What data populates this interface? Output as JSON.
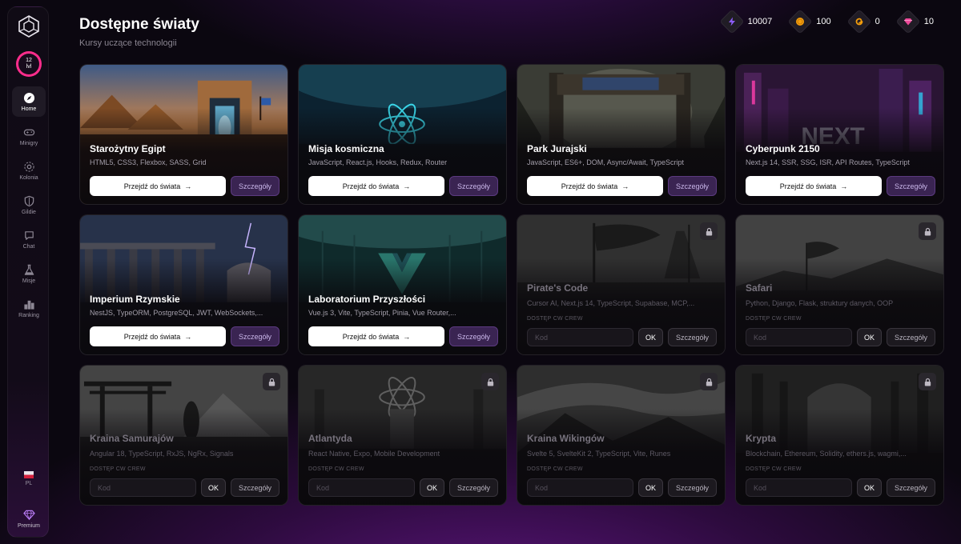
{
  "sidebar": {
    "level": {
      "value": "12",
      "unit": "lvl"
    },
    "nav": [
      {
        "label": "Home",
        "icon": "compass-icon",
        "active": true
      },
      {
        "label": "Minigry",
        "icon": "gamepad-icon"
      },
      {
        "label": "Kolonia",
        "icon": "colony-icon"
      },
      {
        "label": "Gildie",
        "icon": "shield-icon"
      },
      {
        "label": "Chat",
        "icon": "chat-icon"
      },
      {
        "label": "Misje",
        "icon": "flask-icon"
      },
      {
        "label": "Ranking",
        "icon": "ranking-icon"
      }
    ],
    "language": {
      "label": "PL",
      "icon": "flag-pl-icon"
    },
    "premium": {
      "label": "Premium",
      "icon": "diamond-icon"
    }
  },
  "header": {
    "title": "Dostępne światy",
    "subtitle": "Kursy uczące technologii"
  },
  "stats": [
    {
      "icon": "energy-icon",
      "value": "10007",
      "color": "#8b5cf6"
    },
    {
      "icon": "coin-icon",
      "value": "100",
      "color": "#f59e0b"
    },
    {
      "icon": "spiral-icon",
      "value": "0",
      "color": "#f59e0b"
    },
    {
      "icon": "gem-icon",
      "value": "10",
      "color": "#ec4899"
    }
  ],
  "buttons": {
    "enter": "Przejdź do świata",
    "details": "Szczegóły",
    "ok": "OK"
  },
  "access": {
    "label": "DOSTĘP CW CREW",
    "placeholder": "Kod"
  },
  "worlds": [
    {
      "name": "Starożytny Egipt",
      "tags": "HTML5, CSS3, Flexbox, SASS, Grid",
      "locked": false,
      "theme": "egypt"
    },
    {
      "name": "Misja kosmiczna",
      "tags": "JavaScript, React.js, Hooks, Redux, Router",
      "locked": false,
      "theme": "space"
    },
    {
      "name": "Park Jurajski",
      "tags": "JavaScript, ES6+, DOM, Async/Await, TypeScript",
      "locked": false,
      "theme": "jurassic"
    },
    {
      "name": "Cyberpunk 2150",
      "tags": "Next.js 14, SSR, SSG, ISR, API Routes, TypeScript",
      "locked": false,
      "theme": "cyber"
    },
    {
      "name": "Imperium Rzymskie",
      "tags": "NestJS, TypeORM, PostgreSQL, JWT, WebSockets,...",
      "locked": false,
      "theme": "rome"
    },
    {
      "name": "Laboratorium Przyszłości",
      "tags": "Vue.js 3, Vite, TypeScript, Pinia, Vue Router,...",
      "locked": false,
      "theme": "lab"
    },
    {
      "name": "Pirate's Code",
      "tags": "Cursor AI, Next.js 14, TypeScript, Supabase, MCP,...",
      "locked": true,
      "theme": "pirate"
    },
    {
      "name": "Safari",
      "tags": "Python, Django, Flask, struktury danych, OOP",
      "locked": true,
      "theme": "safari"
    },
    {
      "name": "Kraina Samurajów",
      "tags": "Angular 18, TypeScript, RxJS, NgRx, Signals",
      "locked": true,
      "theme": "samurai"
    },
    {
      "name": "Atlantyda",
      "tags": "React Native, Expo, Mobile Development",
      "locked": true,
      "theme": "atlantis"
    },
    {
      "name": "Kraina Wikingów",
      "tags": "Svelte 5, SvelteKit 2, TypeScript, Vite, Runes",
      "locked": true,
      "theme": "viking"
    },
    {
      "name": "Krypta",
      "tags": "Blockchain, Ethereum, Solidity, ethers.js, wagmi,...",
      "locked": true,
      "theme": "crypt"
    }
  ]
}
